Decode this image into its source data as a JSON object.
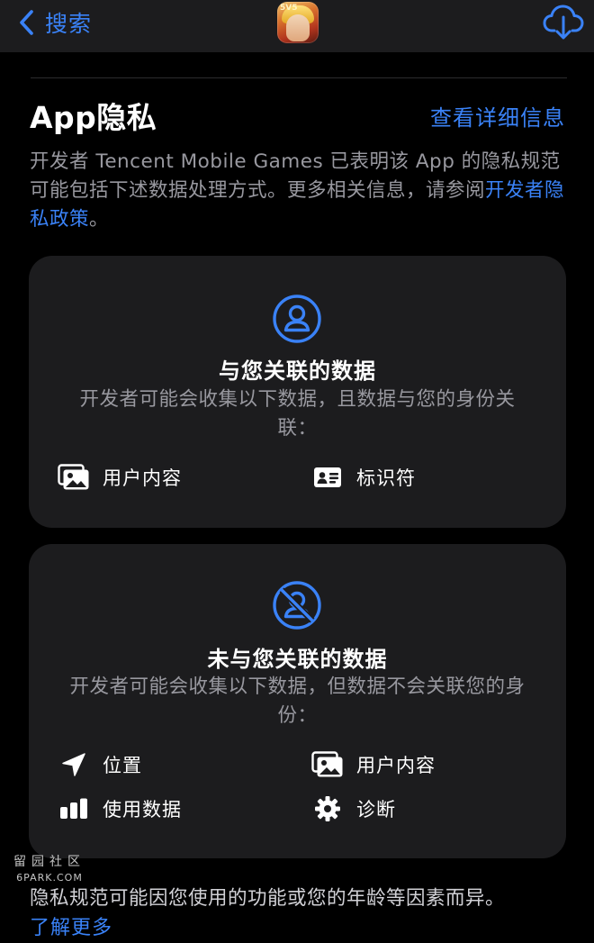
{
  "nav": {
    "back_label": "搜索",
    "app_icon_text": "5V5"
  },
  "privacy": {
    "title": "App隐私",
    "details_link": "查看详细信息",
    "description_prefix": "开发者 Tencent Mobile Games 已表明该 App 的隐私规范可能包括下述数据处理方式。更多相关信息，请参阅",
    "policy_link": "开发者隐私政策",
    "description_suffix": "。"
  },
  "linked_card": {
    "icon": "person-circle-icon",
    "title": "与您关联的数据",
    "description": "开发者可能会收集以下数据，且数据与您的身份关联：",
    "items": [
      {
        "label": "用户内容",
        "icon": "photos-icon"
      },
      {
        "label": "标识符",
        "icon": "id-card-icon"
      }
    ]
  },
  "unlinked_card": {
    "icon": "person-crossed-circle-icon",
    "title": "未与您关联的数据",
    "description": "开发者可能会收集以下数据，但数据不会关联您的身份：",
    "items": [
      {
        "label": "位置",
        "icon": "location-arrow-icon"
      },
      {
        "label": "用户内容",
        "icon": "photos-icon"
      },
      {
        "label": "使用数据",
        "icon": "bar-chart-icon"
      },
      {
        "label": "诊断",
        "icon": "gear-icon"
      }
    ]
  },
  "footer": {
    "note": "隐私规范可能因您使用的功能或您的年龄等因素而异。",
    "learn_more": "了解更多"
  },
  "watermark": {
    "cn": "留园社区",
    "en": "6PARK.COM"
  },
  "colors": {
    "accent": "#3a82f7",
    "card_bg": "#1c1c1e",
    "secondary_text": "#98989f"
  }
}
